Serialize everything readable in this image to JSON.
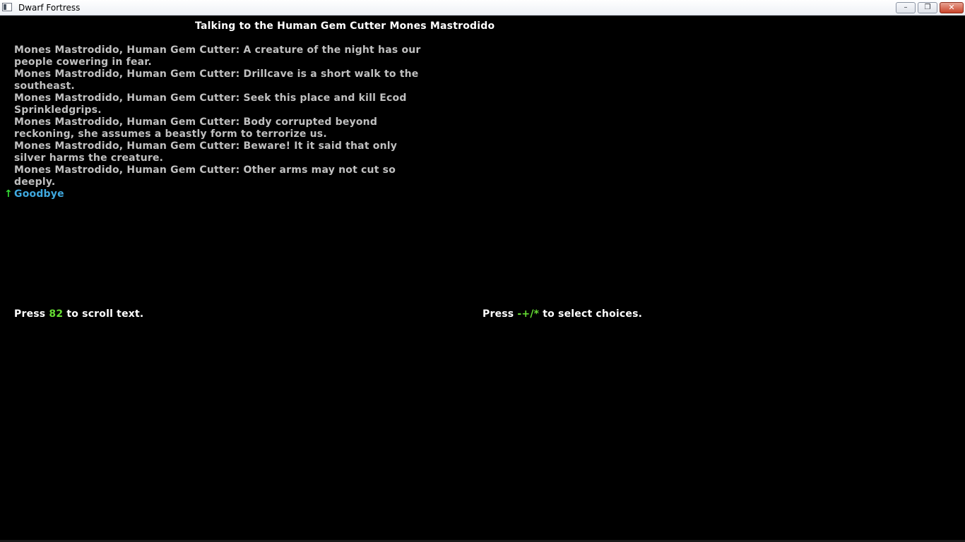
{
  "window": {
    "title": "Dwarf Fortress",
    "controls": {
      "minimize": "–",
      "maximize": "❐",
      "close": "✕"
    }
  },
  "conversation": {
    "title": "Talking to the Human Gem Cutter Mones Mastrodido",
    "lines": [
      "Mones Mastrodido, Human Gem Cutter: A creature of the night has our people cowering in fear.",
      "Mones Mastrodido, Human Gem Cutter: Drillcave is a short walk to the southeast.",
      "Mones Mastrodido, Human Gem Cutter: Seek this place and kill Ecod Sprinkledgrips.",
      "Mones Mastrodido, Human Gem Cutter: Body corrupted beyond reckoning, she assumes a beastly form to terrorize us.",
      "Mones Mastrodido, Human Gem Cutter: Beware!  It it said that only silver harms the creature.",
      "Mones Mastrodido, Human Gem Cutter: Other arms may not cut so deeply."
    ],
    "choices": [
      {
        "marker": "↑",
        "label": "Goodbye"
      }
    ]
  },
  "hints": {
    "scroll": {
      "prefix": "Press ",
      "key": "82",
      "suffix": " to scroll text."
    },
    "select": {
      "prefix": "Press ",
      "key": "-+/*",
      "suffix": " to select choices."
    }
  },
  "colors": {
    "background": "#000000",
    "dialog_text": "#c0c0c0",
    "title_text": "#ffffff",
    "key_highlight": "#66dd33",
    "choice_text": "#3fa9e0",
    "choice_marker": "#33dd33"
  }
}
